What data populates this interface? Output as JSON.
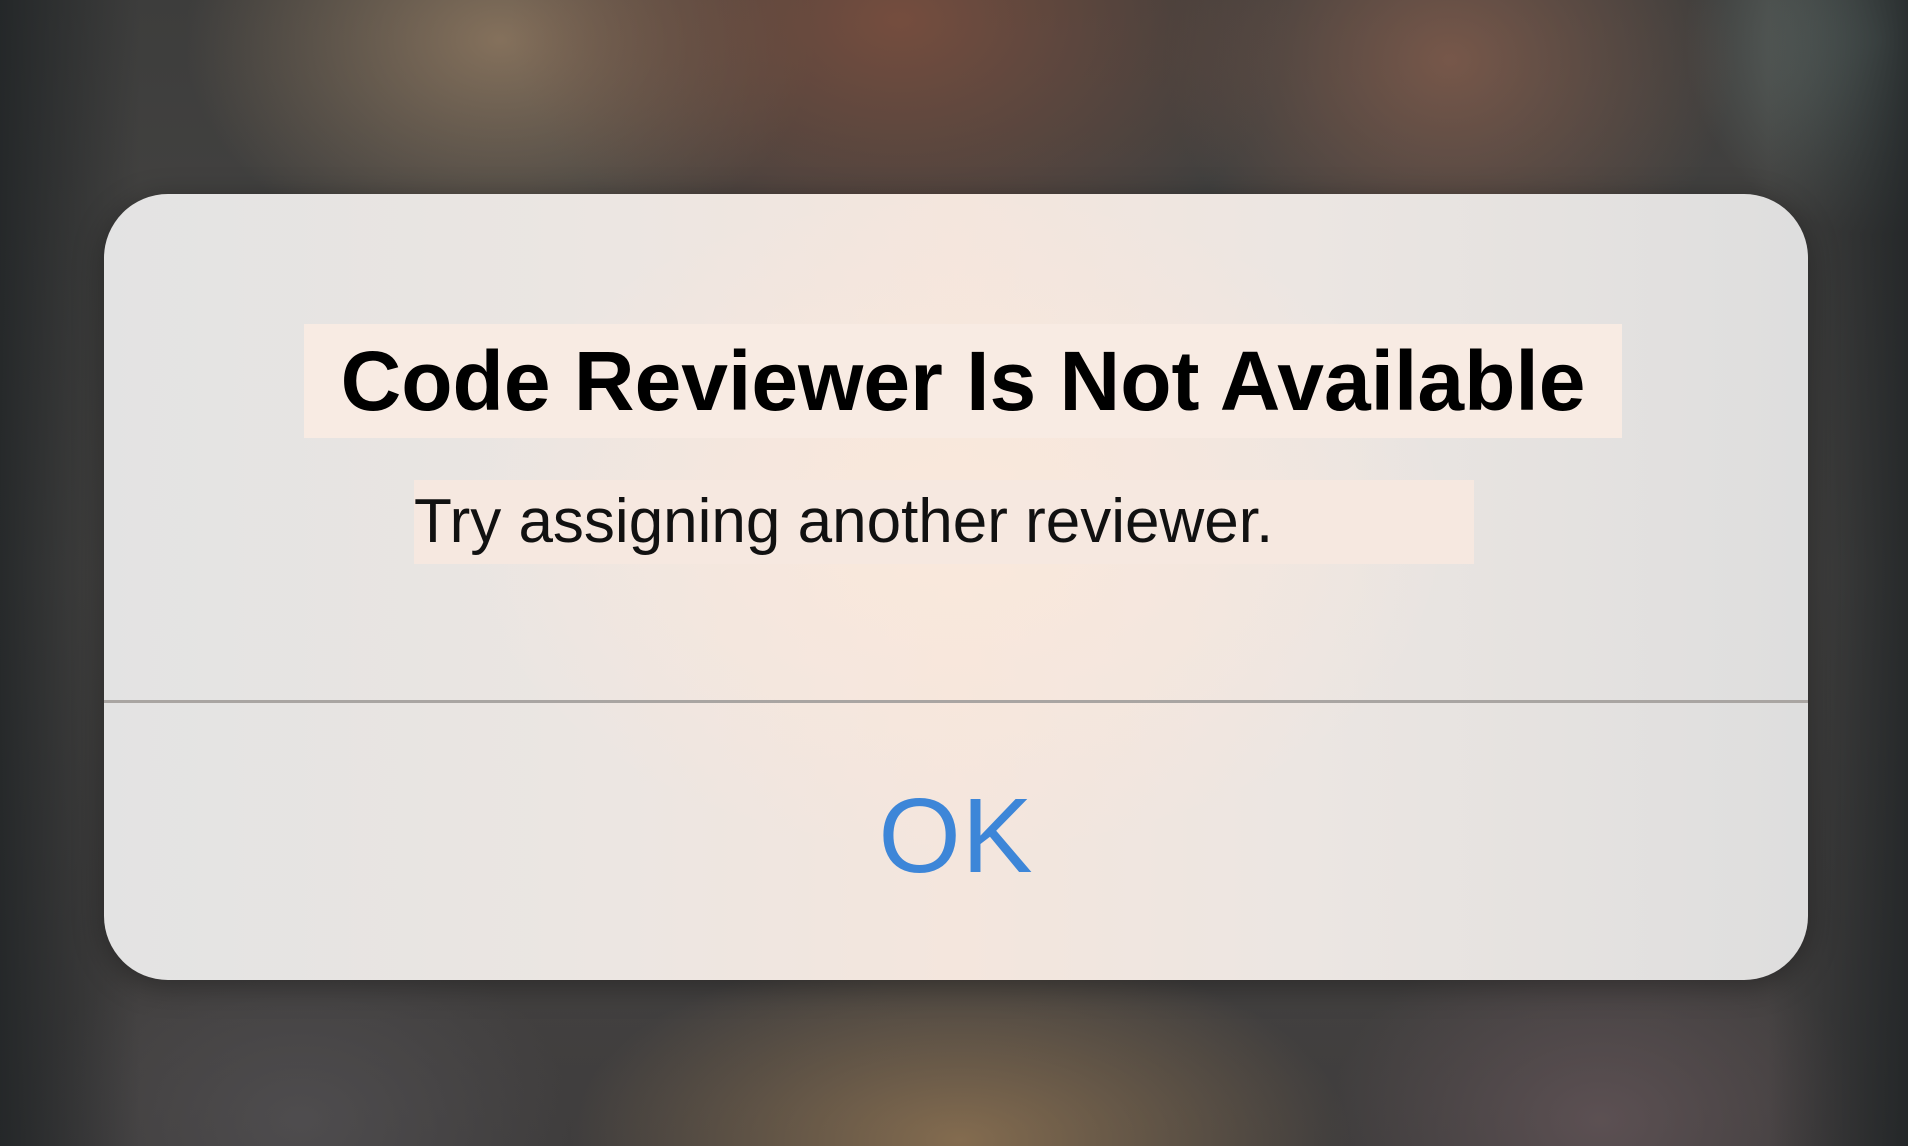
{
  "alert": {
    "title": "Code Reviewer Is Not Available",
    "message": "Try assigning another reviewer.",
    "ok_label": "OK"
  },
  "colors": {
    "button_text": "#3d86d8",
    "title_text": "#000000",
    "divider": "#a9a5a2"
  }
}
